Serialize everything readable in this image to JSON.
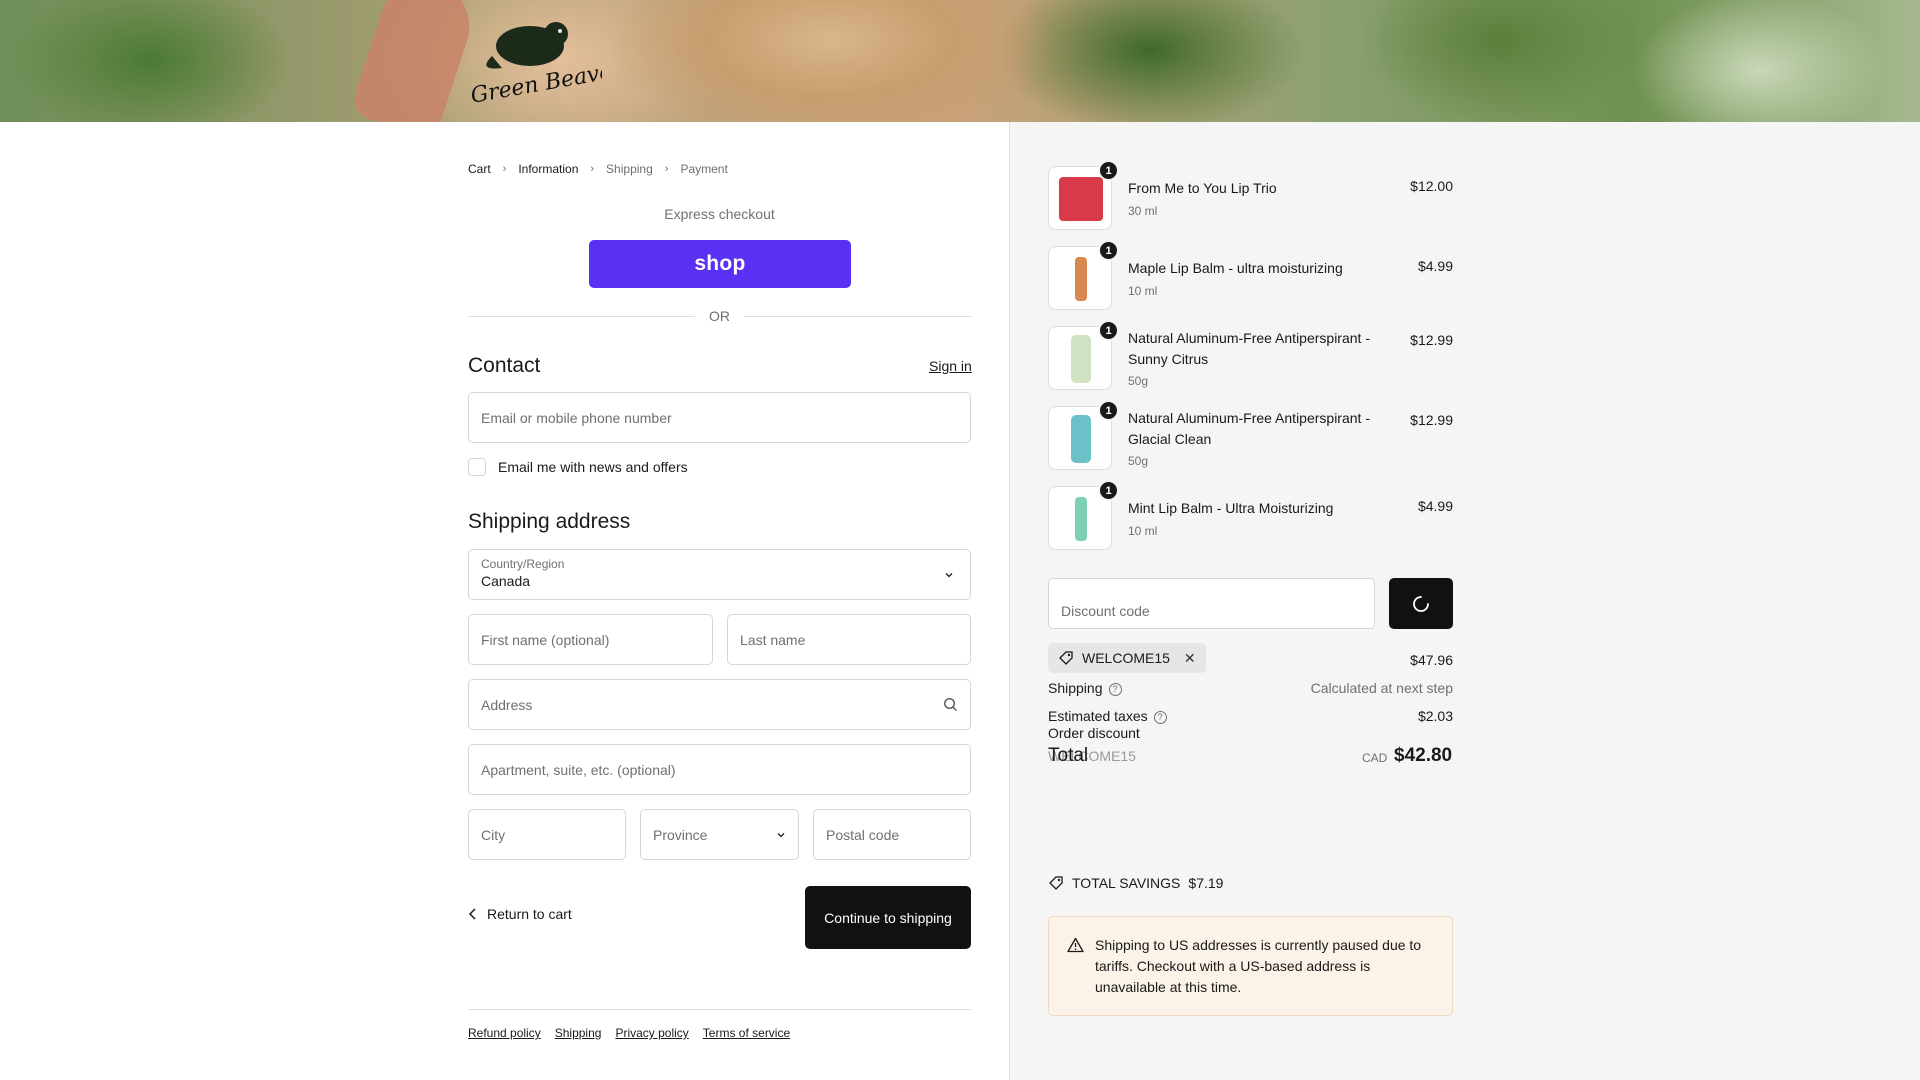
{
  "brand": {
    "logo_text": "Green Beaver"
  },
  "breadcrumb": {
    "items": [
      {
        "label": "Cart",
        "state": "link"
      },
      {
        "label": "Information",
        "state": "current"
      },
      {
        "label": "Shipping",
        "state": "upcoming"
      },
      {
        "label": "Payment",
        "state": "upcoming"
      }
    ]
  },
  "express": {
    "label": "Express checkout",
    "shop_button": "shop",
    "or": "OR"
  },
  "contact": {
    "title": "Contact",
    "sign_in": "Sign in",
    "email_placeholder": "Email or mobile phone number",
    "newsletter_label": "Email me with news and offers",
    "newsletter_checked": false
  },
  "shipping": {
    "title": "Shipping address",
    "country_label": "Country/Region",
    "country_value": "Canada",
    "first_name_placeholder": "First name (optional)",
    "last_name_placeholder": "Last name",
    "address_placeholder": "Address",
    "apartment_placeholder": "Apartment, suite, etc. (optional)",
    "city_placeholder": "City",
    "province_placeholder": "Province",
    "postal_placeholder": "Postal code"
  },
  "actions": {
    "return_label": "Return to cart",
    "continue_label": "Continue to shipping"
  },
  "footer": {
    "links": [
      "Refund policy",
      "Shipping",
      "Privacy policy",
      "Terms of service"
    ]
  },
  "products": [
    {
      "name": "From Me to You Lip Trio",
      "variant": "30 ml",
      "price": "$12.00",
      "qty": "1",
      "color": "#d83a4a"
    },
    {
      "name": "Maple Lip Balm - ultra moisturizing",
      "variant": "10 ml",
      "price": "$4.99",
      "qty": "1",
      "color": "#d9894f"
    },
    {
      "name": "Natural Aluminum-Free Antiperspirant - Sunny Citrus",
      "variant": "50g",
      "price": "$12.99",
      "qty": "1",
      "color": "#cfe3c2"
    },
    {
      "name": "Natural Aluminum-Free Antiperspirant - Glacial Clean",
      "variant": "50g",
      "price": "$12.99",
      "qty": "1",
      "color": "#6cc1c9"
    },
    {
      "name": "Mint Lip Balm - Ultra Moisturizing",
      "variant": "10 ml",
      "price": "$4.99",
      "qty": "1",
      "color": "#7fcfb6"
    }
  ],
  "discount": {
    "placeholder": "Discount code",
    "applied_code": "WELCOME15"
  },
  "summary": {
    "subtotal": "$47.96",
    "shipping_label": "Shipping",
    "shipping_value": "Calculated at next step",
    "taxes_label": "Estimated taxes",
    "taxes_value": "$2.03",
    "order_discount_label": "Order discount",
    "order_discount_code": "WELCOME15",
    "total_label": "Total",
    "currency": "CAD",
    "total_value": "$42.80"
  },
  "savings": {
    "label": "TOTAL SAVINGS",
    "amount": "$7.19"
  },
  "notice": {
    "text": "Shipping to US addresses is currently paused due to tariffs. Checkout with a US-based address is unavailable at this time."
  }
}
